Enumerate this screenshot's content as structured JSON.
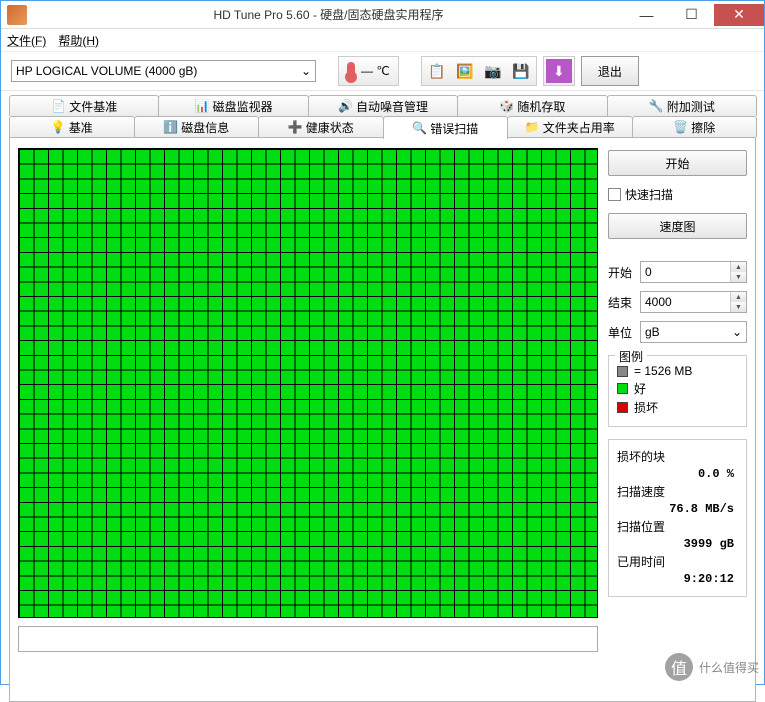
{
  "titlebar": {
    "title": "HD Tune Pro 5.60 - 硬盘/固态硬盘实用程序"
  },
  "menu": {
    "file": "文件(F)",
    "help": "帮助(H)"
  },
  "toolbar": {
    "drive": "HP   LOGICAL VOLUME (4000 gB)",
    "temp": "— ℃",
    "exit": "退出"
  },
  "tabs_top": [
    {
      "label": "文件基准",
      "icon": "📄"
    },
    {
      "label": "磁盘监视器",
      "icon": "📊"
    },
    {
      "label": "自动噪音管理",
      "icon": "🔊"
    },
    {
      "label": "随机存取",
      "icon": "🎲"
    },
    {
      "label": "附加测试",
      "icon": "🔧"
    }
  ],
  "tabs_bottom": [
    {
      "label": "基准",
      "icon": "💡"
    },
    {
      "label": "磁盘信息",
      "icon": "ℹ️"
    },
    {
      "label": "健康状态",
      "icon": "➕"
    },
    {
      "label": "错误扫描",
      "icon": "🔍",
      "active": true
    },
    {
      "label": "文件夹占用率",
      "icon": "📁"
    },
    {
      "label": "擦除",
      "icon": "🗑️"
    }
  ],
  "side": {
    "start": "开始",
    "quickscan": "快速扫描",
    "speedmap": "速度图",
    "start_label": "开始",
    "start_val": "0",
    "end_label": "结束",
    "end_val": "4000",
    "unit_label": "单位",
    "unit_val": "gB",
    "legend": {
      "title": "图例",
      "blocksize": "= 1526 MB",
      "good": "好",
      "bad": "损坏"
    },
    "stats": {
      "damaged_label": "损坏的块",
      "damaged_val": "0.0 %",
      "speed_label": "扫描速度",
      "speed_val": "76.8 MB/s",
      "pos_label": "扫描位置",
      "pos_val": "3999 gB",
      "time_label": "已用时间",
      "time_val": "9:20:12"
    }
  },
  "watermark": "什么值得买"
}
